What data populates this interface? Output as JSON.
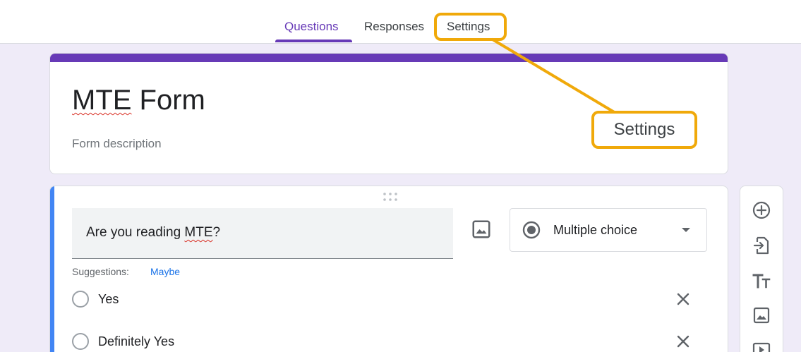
{
  "tabs": [
    {
      "label": "Questions",
      "active": true
    },
    {
      "label": "Responses",
      "active": false
    },
    {
      "label": "Settings",
      "active": false,
      "highlighted": true
    }
  ],
  "form": {
    "title_underlined": "MTE",
    "title_rest": " Form",
    "description_placeholder": "Form description"
  },
  "callout": {
    "label": "Settings"
  },
  "question": {
    "text_before": "Are you reading ",
    "text_underlined": "MTE",
    "text_after": "?",
    "type": "Multiple choice",
    "type_icon": "radio-checked-icon",
    "suggestions_label": "Suggestions:",
    "suggestion": "Maybe",
    "options": [
      {
        "label": "Yes"
      },
      {
        "label": "Definitely Yes"
      }
    ]
  },
  "toolbar": {
    "icons": [
      "add-question-icon",
      "import-questions-icon",
      "add-title-icon",
      "add-image-icon",
      "add-video-icon"
    ]
  },
  "colors": {
    "accent": "#673ab7",
    "highlight": "#f0a90a",
    "question_bar": "#4285f4",
    "background": "#efebf8",
    "link": "#1a73e8"
  }
}
